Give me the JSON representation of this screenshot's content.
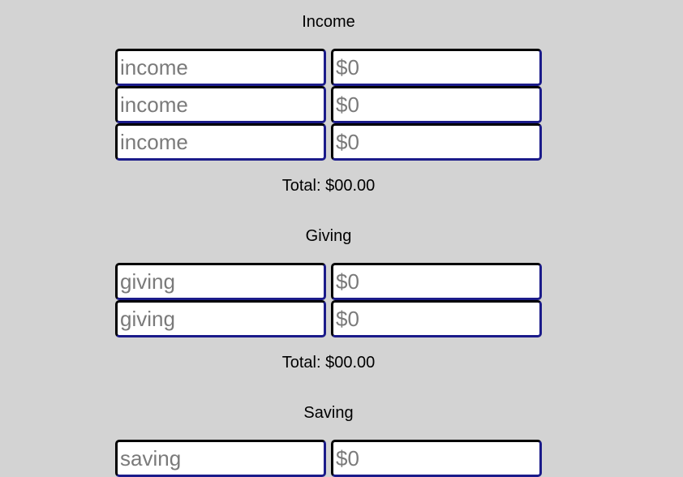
{
  "sections": {
    "income": {
      "title": "Income",
      "rows": [
        {
          "name_placeholder": "income",
          "amount_placeholder": "$0"
        },
        {
          "name_placeholder": "income",
          "amount_placeholder": "$0"
        },
        {
          "name_placeholder": "income",
          "amount_placeholder": "$0"
        }
      ],
      "total": "Total: $00.00"
    },
    "giving": {
      "title": "Giving",
      "rows": [
        {
          "name_placeholder": "giving",
          "amount_placeholder": "$0"
        },
        {
          "name_placeholder": "giving",
          "amount_placeholder": "$0"
        }
      ],
      "total": "Total: $00.00"
    },
    "saving": {
      "title": "Saving",
      "rows": [
        {
          "name_placeholder": "saving",
          "amount_placeholder": "$0"
        }
      ]
    }
  },
  "colors": {
    "background": "#d3d3d3",
    "input_border": "#1b1b8a",
    "placeholder": "#7a7a7a"
  }
}
